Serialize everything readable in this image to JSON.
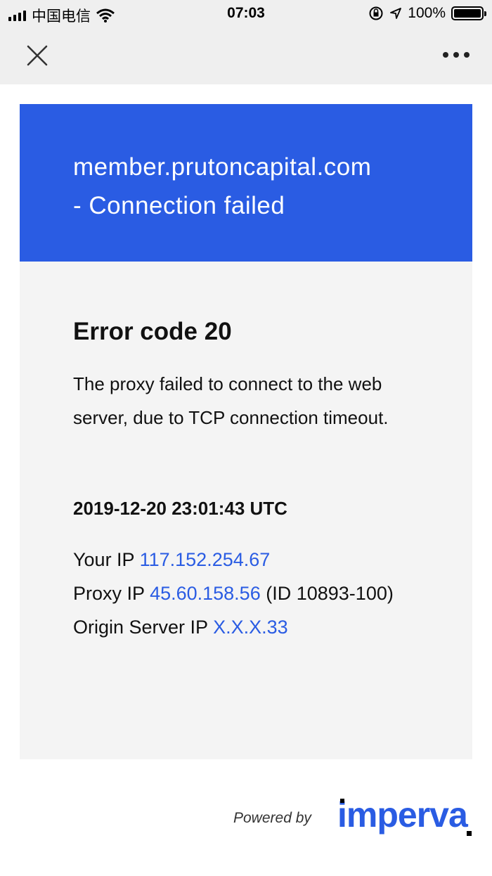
{
  "status_bar": {
    "carrier": "中国电信",
    "time": "07:03",
    "battery": "100%",
    "battery_level": 1.0
  },
  "nav": {
    "close_icon": "close-icon",
    "more_icon": "more-icon"
  },
  "banner": {
    "title_line1": "member.prutoncapital.com",
    "title_line2": "- Connection failed"
  },
  "error": {
    "title": "Error code 20",
    "description": "The proxy failed to connect to the web server, due to TCP connection timeout.",
    "timestamp": "2019-12-20 23:01:43 UTC"
  },
  "ips": {
    "your_ip_label": "Your IP",
    "your_ip": "117.152.254.67",
    "proxy_ip_label": "Proxy IP",
    "proxy_ip": "45.60.158.56",
    "proxy_id": "(ID 10893-100)",
    "origin_label": "Origin Server IP",
    "origin_ip": "X.X.X.33"
  },
  "footer": {
    "powered_by": "Powered by",
    "brand": "imperva"
  },
  "colors": {
    "accent": "#2a5ce3",
    "panel": "#f4f4f4",
    "bar": "#efefef"
  }
}
